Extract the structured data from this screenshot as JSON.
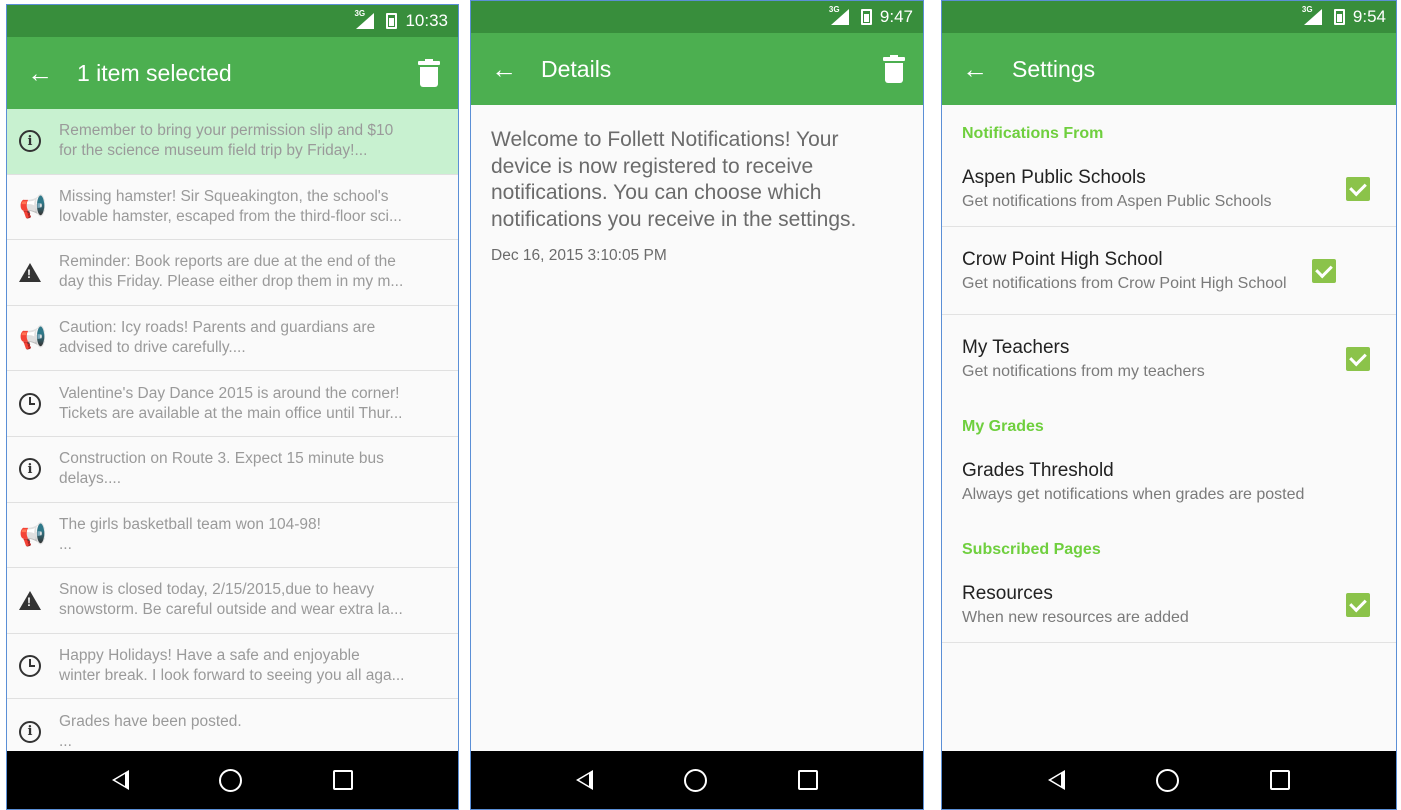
{
  "colors": {
    "statusbar": "#388e3c",
    "appbar": "#4caf50",
    "selected_row": "#c8f1d0",
    "section_header": "#6fcf3e",
    "checkbox": "#8bc34a"
  },
  "phone1": {
    "time": "10:33",
    "network": "3G",
    "title": "1 item selected",
    "rows": [
      {
        "icon": "info-icon",
        "line1": "Remember to bring your permission slip and $10",
        "line2": "for the science museum field trip by Friday!..."
      },
      {
        "icon": "megaphone-icon",
        "line1": "Missing hamster!  Sir Squeakington, the school's",
        "line2": "lovable hamster, escaped from the third-floor sci..."
      },
      {
        "icon": "warning-icon",
        "line1": "Reminder: Book reports are due at the end of the",
        "line2": "day this Friday.  Please either drop them in my m..."
      },
      {
        "icon": "megaphone-icon",
        "line1": "Caution: Icy roads!  Parents and guardians are",
        "line2": "advised to drive carefully...."
      },
      {
        "icon": "alarm-icon",
        "line1": "Valentine's Day Dance 2015 is around the corner!",
        "line2": "Tickets are available at the main office until Thur..."
      },
      {
        "icon": "info-icon",
        "line1": "Construction on Route 3. Expect 15 minute bus",
        "line2": "delays...."
      },
      {
        "icon": "megaphone-icon",
        "line1": "The girls basketball team won 104-98!",
        "line2": "..."
      },
      {
        "icon": "warning-icon",
        "line1": "Snow is closed today, 2/15/2015,due to heavy",
        "line2": "snowstorm.  Be careful outside and wear extra la..."
      },
      {
        "icon": "alarm-icon",
        "line1": "Happy Holidays!  Have a safe and enjoyable",
        "line2": "winter break.  I look forward to seeing you all aga..."
      },
      {
        "icon": "info-icon",
        "line1": "Grades have been posted.",
        "line2": "..."
      }
    ]
  },
  "phone2": {
    "time": "9:47",
    "network": "3G",
    "title": "Details",
    "message": "Welcome to Follett Notifications! Your device is now registered to receive notifications. You can choose which notifications you receive in the settings.",
    "date": "Dec 16, 2015 3:10:05 PM"
  },
  "phone3": {
    "time": "9:54",
    "network": "3G",
    "title": "Settings",
    "sections": {
      "notifications_from": "Notifications From",
      "my_grades": "My Grades",
      "subscribed_pages": "Subscribed Pages"
    },
    "prefs": {
      "aspen": {
        "title": "Aspen Public Schools",
        "summary": "Get notifications from Aspen Public Schools",
        "checked": true
      },
      "crow": {
        "title": "Crow Point High School",
        "summary": "Get notifications from Crow Point High School",
        "checked": true
      },
      "teachers": {
        "title": "My Teachers",
        "summary": "Get notifications from my teachers",
        "checked": true
      },
      "grades": {
        "title": "Grades Threshold",
        "summary": "Always get notifications when grades are posted"
      },
      "resources": {
        "title": "Resources",
        "summary": "When new resources are added",
        "checked": true
      }
    }
  }
}
